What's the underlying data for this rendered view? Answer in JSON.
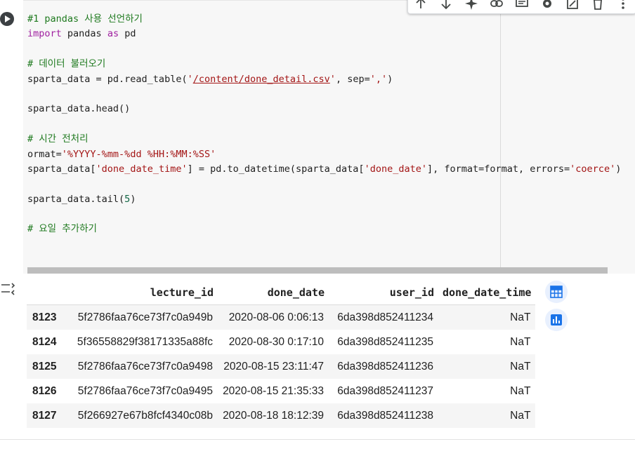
{
  "cell": {
    "code_lines": [
      "#1 pandas 사용 선언하기",
      "import pandas as pd",
      "",
      "# 데이터 불러오기",
      "sparta_data = pd.read_table('/content/done_detail.csv', sep=',')",
      "",
      "sparta_data.head()",
      "",
      "# 시간 전처리",
      "ormat='%YYYY-%mm-%dd %HH:%MM:%SS'",
      "sparta_data['done_date_time'] = pd.to_datetime(sparta_data['done_date'], format=format, errors='coerce')",
      "",
      "sparta_data.tail(5)",
      "",
      "# 요일 추가하기"
    ]
  },
  "toolbar": {
    "icons": [
      "arrow-up-icon",
      "arrow-down-icon",
      "sparkle-icon",
      "link-icon",
      "comment-icon",
      "gear-icon",
      "mirror-cell-icon",
      "trash-icon",
      "more-vert-icon"
    ]
  },
  "output": {
    "table": {
      "columns": [
        "",
        "lecture_id",
        "done_date",
        "user_id",
        "done_date_time"
      ],
      "rows": [
        [
          "8123",
          "5f2786faa76ce73f7c0a949b",
          "2020-08-06 0:06:13",
          "6da398d852411234",
          "NaT"
        ],
        [
          "8124",
          "5f36558829f38171335a88fc",
          "2020-08-30 0:17:10",
          "6da398d852411235",
          "NaT"
        ],
        [
          "8125",
          "5f2786faa76ce73f7c0a9498",
          "2020-08-15 23:11:47",
          "6da398d852411236",
          "NaT"
        ],
        [
          "8126",
          "5f2786faa76ce73f7c0a9495",
          "2020-08-15 21:35:33",
          "6da398d852411237",
          "NaT"
        ],
        [
          "8127",
          "5f266927e67b8fcf4340c08b",
          "2020-08-18 18:12:39",
          "6da398d852411238",
          "NaT"
        ]
      ]
    },
    "side_buttons": [
      "table-view-icon",
      "chart-suggest-icon"
    ]
  },
  "colors": {
    "editor_bg": "#f7f7f7",
    "comment": "#1f7a1f",
    "keyword": "#a020a0",
    "string": "#a31515",
    "number": "#116644",
    "accent_blue": "#1a73e8"
  }
}
